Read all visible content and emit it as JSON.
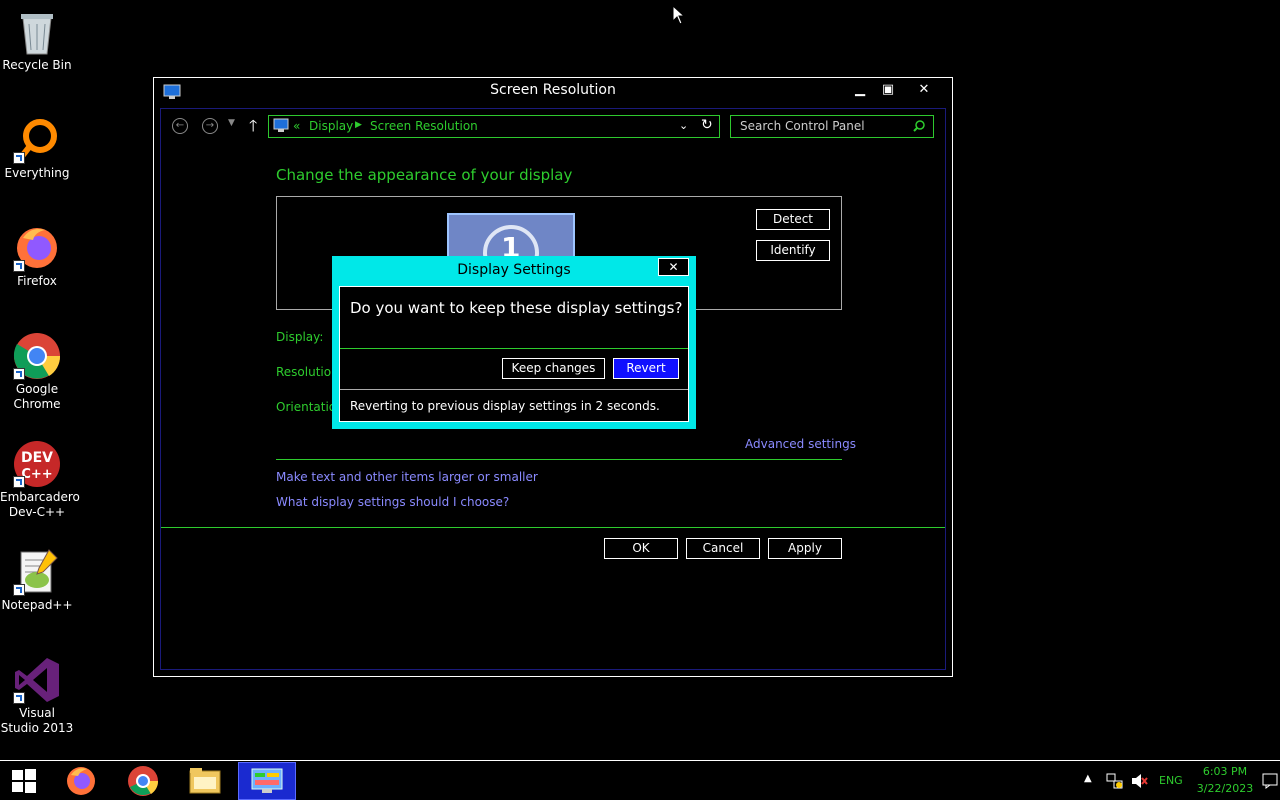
{
  "desktop": {
    "icons": [
      {
        "label": "Recycle Bin"
      },
      {
        "label": "Everything"
      },
      {
        "label": "Firefox"
      },
      {
        "label": "Google Chrome"
      },
      {
        "label": "Embarcadero Dev-C++"
      },
      {
        "label": "Notepad++"
      },
      {
        "label": "Visual Studio 2013"
      }
    ]
  },
  "window": {
    "title": "Screen Resolution",
    "address": {
      "separator": "«",
      "crumb1": "Display",
      "crumb2": "Screen Resolution"
    },
    "search_placeholder": "Search Control Panel",
    "heading": "Change the appearance of your display",
    "detect_label": "Detect",
    "identify_label": "Identify",
    "monitor_number": "1",
    "display_label": "Display:",
    "resolution_label": "Resolution",
    "orientation_label": "Orientation",
    "advanced_link": "Advanced settings",
    "link_text_size": "Make text and other items larger or smaller",
    "link_which_settings": "What display settings should I choose?",
    "ok_label": "OK",
    "cancel_label": "Cancel",
    "apply_label": "Apply"
  },
  "dialog": {
    "title": "Display Settings",
    "question": "Do you want to keep these display settings?",
    "keep_label": "Keep changes",
    "revert_label": "Revert",
    "countdown": "Reverting to previous display settings in 2 seconds."
  },
  "taskbar": {
    "language": "ENG",
    "time": "6:03 PM",
    "date": "3/22/2023"
  },
  "colors": {
    "accent_green": "#2ecc2e",
    "dialog_border": "#00e8e8",
    "revert_button": "#1010ff",
    "link": "#8a8aff"
  }
}
